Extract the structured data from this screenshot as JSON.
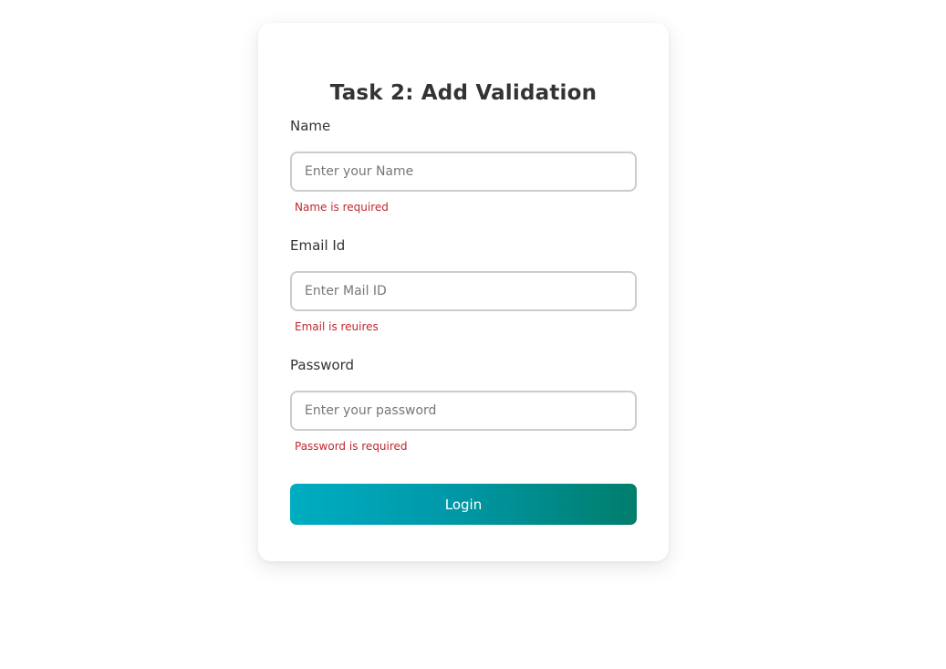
{
  "form": {
    "title": "Task 2: Add Validation",
    "fields": [
      {
        "label": "Name",
        "placeholder": "Enter your Name",
        "value": "",
        "error": "Name is required"
      },
      {
        "label": "Email Id",
        "placeholder": "Enter Mail ID",
        "value": "",
        "error": "Email is reuires"
      },
      {
        "label": "Password",
        "placeholder": "Enter your password",
        "value": "",
        "error": "Password is required"
      }
    ],
    "submit_label": "Login"
  },
  "colors": {
    "error": "#c0282f",
    "button_gradient_start": "#00adc1",
    "button_gradient_end": "#007d6c",
    "input_border": "#cccccc"
  }
}
